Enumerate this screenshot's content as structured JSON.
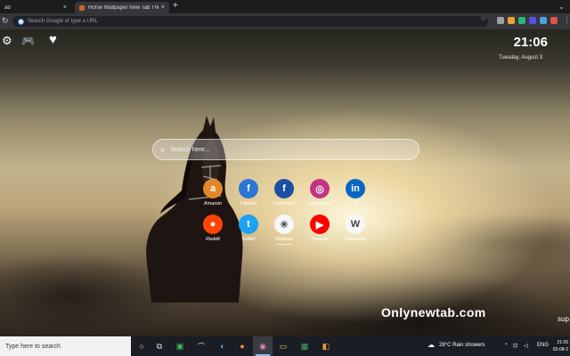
{
  "browser": {
    "tabs": [
      {
        "title": "ab"
      },
      {
        "title": "Horse Wallpaper New Tab Theme"
      }
    ],
    "new_tab_symbol": "+",
    "close_symbol": "×",
    "omnibox_placeholder": "Search Google or type a URL",
    "extensions": [
      {
        "name": "extension-gray",
        "color": "#9e9e9e"
      },
      {
        "name": "extension-orange",
        "color": "#f0a030"
      },
      {
        "name": "extension-green",
        "color": "#24b47e"
      },
      {
        "name": "extension-purple",
        "color": "#5c4ee5"
      },
      {
        "name": "extension-blue",
        "color": "#4aa3df"
      },
      {
        "name": "extension-red",
        "color": "#e05050"
      }
    ]
  },
  "newtab": {
    "clock": "21:06",
    "date": "Tuesday, August 3",
    "search_placeholder": "Search here...",
    "shortcuts": [
      {
        "label": "Amazon",
        "glyph": "a",
        "color": "#e2872a"
      },
      {
        "label": "Flipkart",
        "glyph": "f",
        "color": "#2c74d6"
      },
      {
        "label": "Facebook",
        "glyph": "f",
        "color": "#1d4fa3"
      },
      {
        "label": "Instagram",
        "glyph": "◎",
        "color": "#c13584"
      },
      {
        "label": "in",
        "glyph": "in",
        "color": "#0a66c2"
      },
      {
        "label": "Reddit",
        "glyph": "●",
        "color": "#ff4500"
      },
      {
        "label": "Twitter",
        "glyph": "t",
        "color": "#1da1f2"
      },
      {
        "label": "Walmart",
        "glyph": "✳",
        "color": "#f6f6f6"
      },
      {
        "label": "Youtube",
        "glyph": "▶",
        "color": "#ff0000"
      },
      {
        "label": "Wikipedia",
        "glyph": "W",
        "color": "#f6f6f6"
      }
    ],
    "brand": "Onlynewtab.com",
    "side_text": "sup"
  },
  "taskbar": {
    "search_placeholder": "Type here to search",
    "weather": "28°C  Rain showers",
    "language": "ENG",
    "time": "21:06",
    "date": "03-08-2"
  }
}
